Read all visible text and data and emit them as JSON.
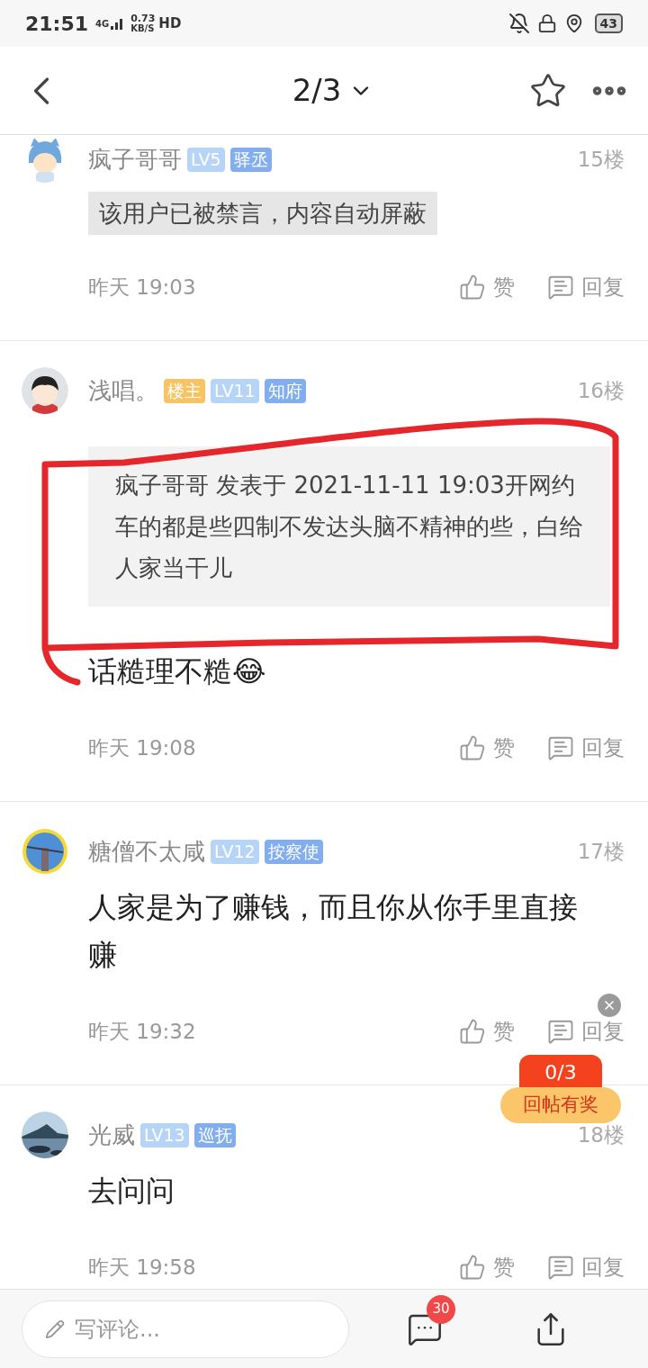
{
  "status_bar": {
    "time": "21:51",
    "network": "4G",
    "speed": "0.73",
    "speed_unit": "KB/S",
    "hd": "HD",
    "battery": "43"
  },
  "header": {
    "page": "2/3"
  },
  "posts": [
    {
      "name": "疯子哥哥",
      "badges": [
        {
          "text": "LV5",
          "color": "#b6d4f8"
        },
        {
          "text": "驿丞",
          "color": "#82aef0"
        }
      ],
      "floor": "15楼",
      "content": [
        {
          "kind": "banned",
          "text": "该用户已被禁言，内容自动屏蔽"
        }
      ],
      "time": "昨天 19:03",
      "like": "赞",
      "reply": "回复"
    },
    {
      "name": "浅唱。",
      "badges": [
        {
          "text": "楼主",
          "color": "#f8c463"
        },
        {
          "text": "LV11",
          "color": "#b6d4f8"
        },
        {
          "text": "知府",
          "color": "#82aef0"
        }
      ],
      "floor": "16楼",
      "content": [
        {
          "kind": "quote",
          "text": "疯子哥哥 发表于 2021-11-11 19:03开网约车的都是些四制不发达头脑不精神的些，白给人家当干儿"
        },
        {
          "kind": "text",
          "text": "话糙理不糙😂"
        }
      ],
      "time": "昨天 19:08",
      "like": "赞",
      "reply": "回复"
    },
    {
      "name": "糖僧不太咸",
      "badges": [
        {
          "text": "LV12",
          "color": "#b6d4f8"
        },
        {
          "text": "按察使",
          "color": "#82aef0"
        }
      ],
      "floor": "17楼",
      "content": [
        {
          "kind": "text",
          "text": "人家是为了赚钱，而且你从你手里直接赚"
        }
      ],
      "time": "昨天 19:32",
      "like": "赞",
      "reply": "回复"
    },
    {
      "name": "光威",
      "badges": [
        {
          "text": "LV13",
          "color": "#b6d4f8"
        },
        {
          "text": "巡抚",
          "color": "#82aef0"
        }
      ],
      "floor": "18楼",
      "content": [
        {
          "kind": "text",
          "text": "去问问"
        }
      ],
      "time": "昨天 19:58",
      "like": "赞",
      "reply": "回复"
    }
  ],
  "reward": {
    "count": "0/3",
    "label": "回帖有奖"
  },
  "bottom_bar": {
    "placeholder": "写评论...",
    "comment_count": "30"
  }
}
